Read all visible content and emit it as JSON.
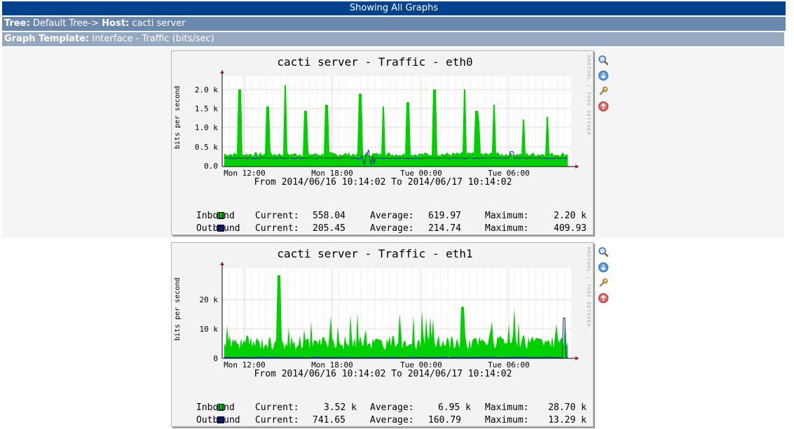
{
  "header": {
    "title": "Showing All Graphs",
    "tree_label": "Tree:",
    "tree_value": "Default Tree->",
    "host_label": "Host:",
    "host_value": "cacti server",
    "template_label": "Graph Template:",
    "template_value": "Interface - Traffic (bits/sec)"
  },
  "graphs": [
    {
      "title": "cacti server - Traffic - eth0",
      "watermark": "RRDTOOL / TOBI OETIKER",
      "ylabel": "bits per second",
      "yticks": [
        "2.0 k",
        "1.5 k",
        "1.0 k",
        "0.5 k",
        "0.0"
      ],
      "xticks": [
        "Mon 12:00",
        "Mon 18:00",
        "Tue 00:00",
        "Tue 06:00"
      ],
      "range": "From 2014/06/16 10:14:02 To 2014/06/17 10:14:02",
      "legend": [
        {
          "name": "Inbound",
          "current_label": "Current:",
          "current": "558.04",
          "average_label": "Average:",
          "average": "619.97",
          "maximum_label": "Maximum:",
          "maximum": "2.20 k",
          "color": "#00cf00"
        },
        {
          "name": "Outbound",
          "current_label": "Current:",
          "current": "205.45",
          "average_label": "Average:",
          "average": "214.74",
          "maximum_label": "Maximum:",
          "maximum": "409.93",
          "color": "#002a97"
        }
      ]
    },
    {
      "title": "cacti server - Traffic - eth1",
      "watermark": "RRDTOOL / TOBI OETIKER",
      "ylabel": "bits per second",
      "yticks": [
        "20 k",
        "10 k",
        "0"
      ],
      "xticks": [
        "Mon 12:00",
        "Mon 18:00",
        "Tue 00:00",
        "Tue 06:00"
      ],
      "range": "From 2014/06/16 10:14:02 To 2014/06/17 10:14:02",
      "legend": [
        {
          "name": "Inbound",
          "current_label": "Current:",
          "current": "3.52 k",
          "average_label": "Average:",
          "average": "6.95 k",
          "maximum_label": "Maximum:",
          "maximum": "28.70 k",
          "color": "#00cf00"
        },
        {
          "name": "Outbound",
          "current_label": "Current:",
          "current": "741.65",
          "average_label": "Average:",
          "average": "160.79",
          "maximum_label": "Maximum:",
          "maximum": "13.29 k",
          "color": "#002a97"
        }
      ]
    }
  ],
  "actions": [
    {
      "icon": "zoom-icon",
      "color": "#3a6fb0"
    },
    {
      "icon": "export-icon",
      "color": "#2f74d0"
    },
    {
      "icon": "properties-icon",
      "color": "#c08a2a"
    },
    {
      "icon": "top-icon",
      "color": "#d04040"
    }
  ],
  "colors": {
    "title_bar": "#00438c",
    "tree_bar": "#6d88ad",
    "template_bar": "#97a9c1",
    "inbound": "#00cf00",
    "outbound": "#002a97"
  }
}
